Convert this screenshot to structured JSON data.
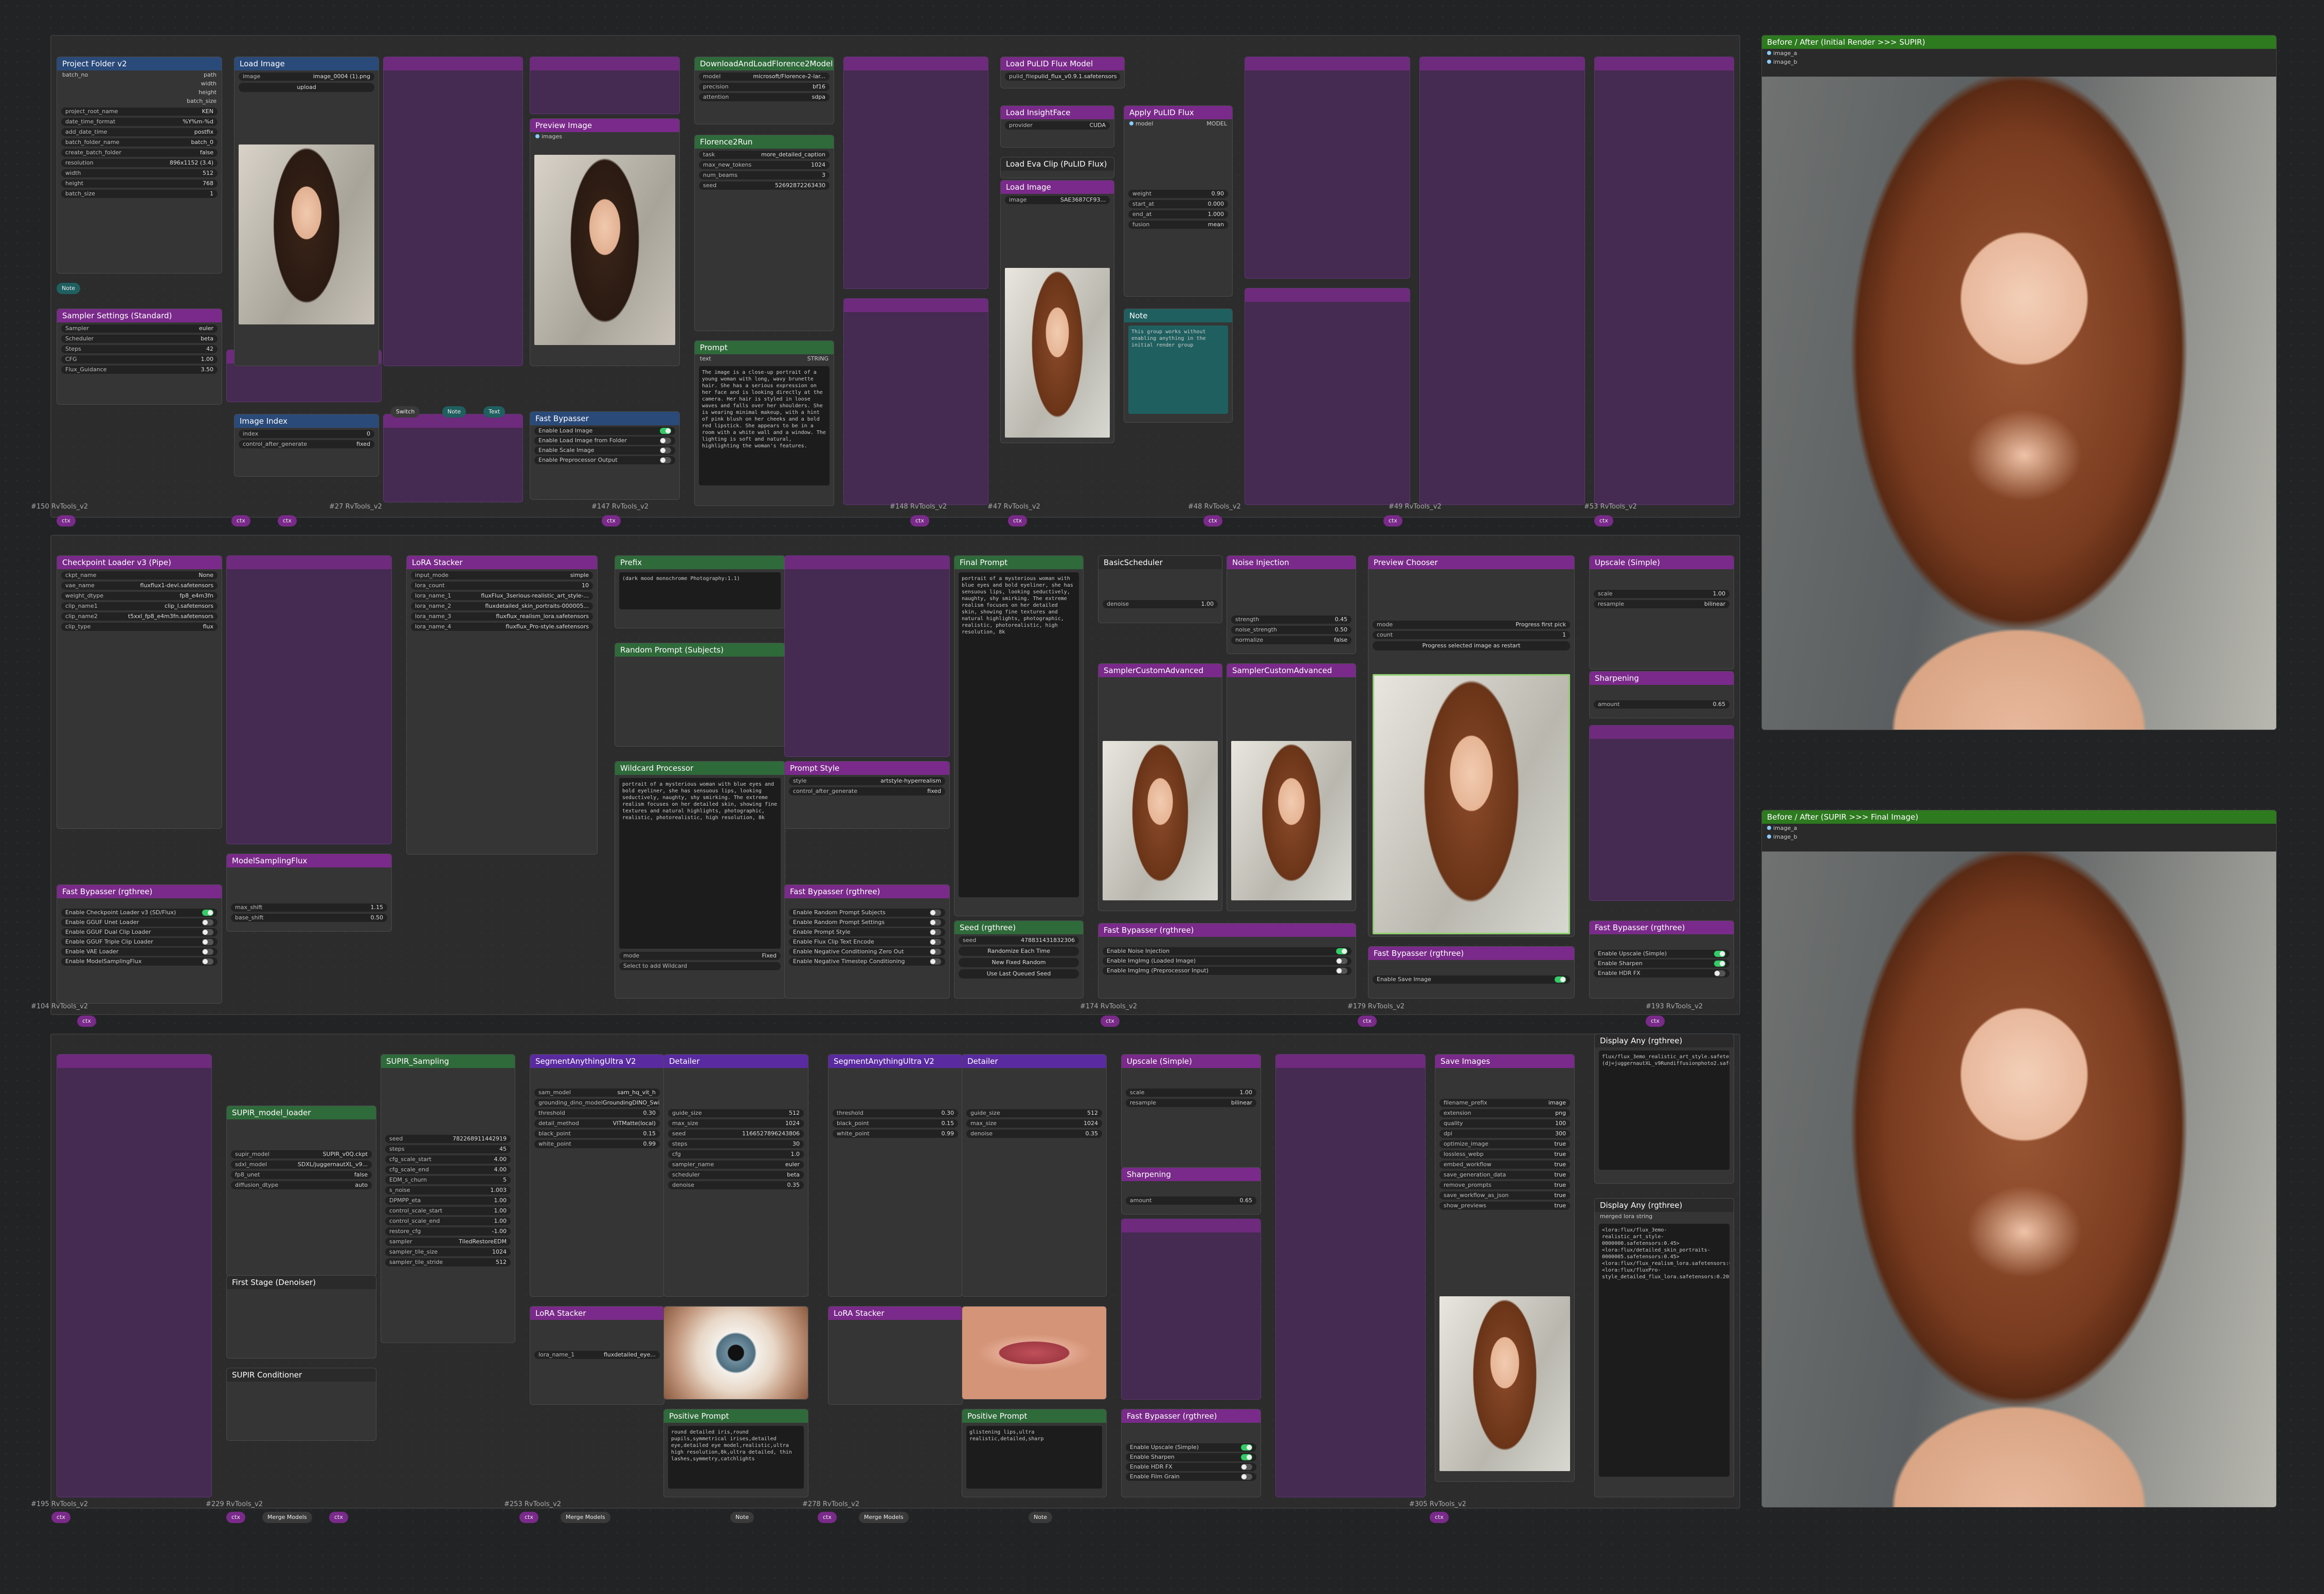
{
  "colors": {
    "canvas": "#222325",
    "node_bg": "#353535",
    "muted": "#4a2a58",
    "title_purple": "#7a2a8a",
    "title_green": "#2f6a3a",
    "title_blue": "#2a4a7a",
    "compare_green": "#2d7a1f",
    "link_blue": "#88ccff"
  },
  "row1": {
    "project": {
      "title": "Project Folder v2",
      "id": "#5 RvTools_v2",
      "project_root_name": "KEN",
      "date_time_format": "%Y%m-%d",
      "add_date_time": "postfix",
      "batch_folder_name": "batch_0",
      "create_batch_folder": "false",
      "relative_path": "",
      "resolution": "896x1152 (3.4)",
      "width": "512",
      "height": "768",
      "batch_size": "1",
      "note": "Note"
    },
    "sampler": {
      "title": "Sampler Settings (Standard)",
      "id": "#4 RvTools_v2",
      "sampler": "euler",
      "scheduler": "beta",
      "steps": "42",
      "cfg": "1.00",
      "flux_guidance": "3.50"
    },
    "load_image": {
      "title": "Load Image",
      "id": "#24",
      "image": "image_0004 (1).png",
      "upload": "upload"
    },
    "image_index": {
      "title": "Image Index",
      "index": "0",
      "control": "fixed"
    },
    "preview": {
      "title": "Preview Image",
      "id": "#20 RvTools_v2",
      "field": "images"
    },
    "fast_bypass": {
      "title": "Fast Bypasser",
      "id": "#25",
      "items": [
        "Enable Load Image",
        "Enable Load Image from Folder",
        "Enable Scale Image",
        "Enable Preprocessor Output"
      ]
    },
    "florence_model": {
      "title": "DownloadAndLoadFlorence2Model",
      "id": "#32 Florence2",
      "model": "microsoft/Florence-2-lar...",
      "precision": "bf16",
      "attention": "sdpa"
    },
    "florence_run": {
      "title": "Florence2Run",
      "id": "#33 Florence2",
      "task": "more_detailed_caption",
      "max_new_tokens": "1024",
      "num_beams": "3",
      "seed": "52692872263430"
    },
    "prompt": {
      "title": "Prompt",
      "field": "text",
      "type": "STRING",
      "text": "The image is a close-up portrait of a young woman with long, wavy brunette hair. She has a serious expression on her face and is looking directly at the camera. Her hair is styled in loose waves and falls over her shoulders. She is wearing minimal makeup, with a hint of pink blush on her cheeks and a bold red lipstick. She appears to be in a room with a white wall and a window. The lighting is soft and natural, highlighting the woman's features."
    },
    "pulid": {
      "title": "Load PuLID Flux Model",
      "id": "#44 PuLID-Flux-Enhanced",
      "file": "pulid_flux_v0.9.1.safetensors",
      "eva": "Load Eva Clip (PuLID Flux)",
      "insight": "Load InsightFace",
      "provider": "CUDA",
      "apply": "Apply PuLID Flux",
      "weight": "0.90",
      "start_at": "0.000",
      "end_at": "1.000",
      "fusion": "mean",
      "image_label": "Load Image",
      "image_file": "SAE3687CF93...",
      "note": "Note",
      "note_text": "This group works without enabling anything in the initial render group"
    }
  },
  "row2": {
    "ckpt": {
      "title": "Checkpoint Loader v3 (Pipe)",
      "id": "#110 RvTools_v2",
      "ckpt_name": "None",
      "vae_name": "fluxflux1-devl.safetensors",
      "weight_dtype": "fp8_e4m3fn",
      "clip_name1": "clip_l.safetensors",
      "clip_name2": "t5xxl_fp8_e4m3fn.safetensors",
      "clip_type": "flux"
    },
    "lora": {
      "title": "LoRA Stacker",
      "id": "#116 efficiency-nodes-comfyui",
      "input_mode": "simple",
      "lora_count": "10",
      "lora_name_1": "fluxFlux_3serious-realistic_art_style-...",
      "lora_name_2": "fluxdetailed_skin_portraits-000005...",
      "lora_name_3": "fluxflux_realism_lora.safetensors",
      "lora_name_4": "fluxflux_Pro-style.safetensors"
    },
    "fast_bypass_rg": {
      "title": "Fast Bypasser (rgthree)",
      "items": [
        "Enable Checkpoint Loader v3 (SD/Flux)",
        "Enable GGUF Unet Loader",
        "Enable GGUF Dual Clip Loader",
        "Enable GGUF Triple Clip Loader",
        "Enable VAE Loader",
        "Enable ModelSamplingFlux"
      ]
    },
    "model_sampling": {
      "title": "ModelSamplingFlux",
      "max_shift": "1.15",
      "base_shift": "0.50"
    },
    "prefix": {
      "title": "Prefix",
      "id": "#143 RvTools_v2",
      "text": "(dark mood monochrome Photography:1.1)"
    },
    "random_subjects": {
      "title": "Random Prompt (Subjects)",
      "id": "#141 Impact-Pack"
    },
    "wildcard": {
      "title": "Wildcard Processor",
      "field": "seed",
      "text": "portrait of a mysterious woman with blue eyes and bold eyeliner, she has sensuous lips, looking seductively, naughty, shy smirking. The extreme realism focuses on her detailed skin, showing fine textures and natural highlights, photographic, realistic, photorealistic, high resolution, 8k",
      "mode": "Fixed",
      "select": "Select to add Wildcard"
    },
    "prompt_style": {
      "title": "Prompt Style",
      "style": "artstyle-hyperrealism",
      "control": "fixed"
    },
    "final_prompt": {
      "title": "Final Prompt",
      "id": "#139 Custom-Scripts"
    },
    "seed": {
      "title": "Seed (rgthree)",
      "id": "#140 rgthree-comfy",
      "seed": "478831431832306",
      "randomize": "Randomize Each Time",
      "new_fixed": "New Fixed Random",
      "last": "Use Last Queued Seed"
    },
    "fast_bypass_seed": {
      "title": "Fast Bypasser (rgthree)",
      "items": [
        "Enable Random Prompt Subjects",
        "Enable Random Prompt Settings",
        "Enable Prompt Style",
        "Enable Flux Clip Text Encode",
        "Enable Negative Conditioning Zero Out",
        "Enable Negative Timestep Conditioning"
      ]
    },
    "basic_scheduler": {
      "title": "BasicScheduler",
      "id": "#172",
      "denoise": "1.00"
    },
    "noise_injection": {
      "title": "Noise Injection",
      "id": "#168 CS_NoiseInjection",
      "strength": "0.45",
      "noise_strength": "0.50",
      "normalize": "false"
    },
    "sampler_adv": {
      "title": "SamplerCustomAdvanced",
      "id": "#179"
    },
    "chooser": {
      "title": "Preview Chooser",
      "id": "#182 cg-image-picker",
      "mode": "Progress first pick",
      "count": "1",
      "status": "Progress selected image as restart"
    },
    "upscale": {
      "title": "Upscale (Simple)",
      "id": "#188 comfy_mtb",
      "scale": "1.00",
      "resample": "bilinear"
    },
    "sharpen": {
      "title": "Sharpening",
      "amount": "0.65"
    },
    "fast_bypass_inj": {
      "title": "Fast Bypasser (rgthree)",
      "items": [
        "Enable Noise Injection",
        "Enable ImgImg (Loaded Image)",
        "Enable ImgImg (Preprocessor Input)"
      ]
    },
    "fast_bypass_save": {
      "title": "Fast Bypasser (rgthree)",
      "items": [
        "Enable Save Image"
      ]
    },
    "fast_bypass_up": {
      "title": "Fast Bypasser (rgthree)",
      "items": [
        "Enable Upscale (Simple)",
        "Enable Sharpen",
        "Enable HDR FX"
      ]
    }
  },
  "row3": {
    "supir": {
      "title": "SUPIR_Sampling",
      "id": "#228 SUPIR_Sampling",
      "seed": "782268911442919",
      "steps": "45",
      "cfg_scale_start": "4.00",
      "cfg_scale_end": "4.00",
      "EDM_s_churn": "5",
      "s_noise": "1.003",
      "DPMPP_eta": "1.00",
      "control_scale_start": "1.00",
      "control_scale_end": "1.00",
      "restore_cfg": "-1.00",
      "sampler": "TiledRestoreEDM",
      "sampler_tile_size": "1024",
      "sampler_tile_stride": "512"
    },
    "supir_model": {
      "title": "SUPIR_model_loader",
      "id": "#221 SUPIR_ModelLoader",
      "supir_model": "SUPIR_v0Q.ckpt",
      "sdxl_model": "SDXL/juggernautXL_v9...",
      "fp8_unet": "false",
      "diffusion_dtype": "auto"
    },
    "supir_conditioner": {
      "title": "SUPIR Conditioner",
      "id": "#225"
    },
    "first_stage": {
      "title": "First Stage (Denoiser)"
    },
    "seg1": {
      "title": "SegmentAnythingUltra V2",
      "id": "#254 LayerStyle_Advance",
      "sam_model": "sam_hq_vit_h",
      "grounding": "GroundingDINO_SwinB (938MB)",
      "threshold": "0.30",
      "detail_method": "VITMatte(local)",
      "black_point": "0.15",
      "white_point": "0.99"
    },
    "detailer1": {
      "title": "Detailer",
      "id": "#245 Detailer",
      "guide_size": "512",
      "max_size": "1024",
      "seed": "1166527896243806",
      "steps": "30",
      "cfg": "1.0",
      "sampler": "euler",
      "scheduler": "beta",
      "denoise": "0.35"
    },
    "eye_lora": {
      "title": "LoRA Stacker",
      "id": "#244 efficiency-nodes-comfyui",
      "lora_name_1": "fluxdetailed_eye..."
    },
    "seg2": {
      "title": "SegmentAnythingUltra V2",
      "id": "#283 LayerStyle_Advance",
      "threshold": "0.30",
      "black_point": "0.15",
      "white_point": "0.99"
    },
    "detailer2": {
      "title": "Detailer",
      "id": "#277 Detailer",
      "guide_size": "512",
      "max_size": "1024",
      "denoise": "0.35"
    },
    "lip_lora": {
      "title": "LoRA Stacker",
      "id": "#275 efficiency-nodes-comfyui"
    },
    "pos_prompt1": {
      "title": "Positive Prompt",
      "text": "round detailed iris,round pupils,symmetrical irises,detailed eye,detailed eye model,realistic,ultra high resolution,8k,ultra detailed, thin lashes,symmetry,catchlights"
    },
    "pos_prompt2": {
      "title": "Positive Prompt",
      "text": "glistening lips,ultra realistic,detailed,sharp"
    },
    "upscale3": {
      "title": "Upscale (Simple)",
      "id": "#295 comfy_mtb",
      "scale": "1.00",
      "resample": "bilinear"
    },
    "sharpen3": {
      "title": "Sharpening",
      "id": "#287 essentials",
      "amount": "0.65"
    },
    "save": {
      "title": "Save Images",
      "id": "#307 RvTools_v2",
      "filename_prefix": "image",
      "format": "png",
      "quality": "100",
      "dpi": "300",
      "optimize_image": "true",
      "lossless_webp": "true",
      "embed_workflow": "true",
      "save_generation_data": "true",
      "remove_prompts": "true",
      "save_workflow_as_json": "true",
      "show_previews": "true"
    },
    "display1": {
      "title": "Display Any (rgthree)",
      "id": "#309 rgthree-comfy",
      "text": "flux/flux_3emo_realistic_art_style.safetensors, (dj=juggernautXL_v9Rundiffusionphoto2.safetensors)"
    },
    "display2": {
      "title": "Display Any (rgthree)",
      "id": "#308 rgthree-comfy",
      "field": "merged lora string",
      "text": "<lora:flux/flux_3emo-realistic_art_style-0000000.safetensors:0.45>\n<lora:flux/detailed_skin_portraits-0000005.safetensors:0.45>\n<lora:flux/flux_realism_lora.safetensors:0.15>\n<lora:flux/fluxPro-style_detailed_flux_lora.safetensors:0.20>"
    },
    "fast_bypass_final": {
      "title": "Fast Bypasser (rgthree)",
      "items": [
        "Enable Upscale (Simple)",
        "Enable Sharpen",
        "Enable HDR FX",
        "Enable Film Grain"
      ]
    }
  },
  "compare": [
    {
      "title": "Before / After (Initial Render >>> SUPIR)",
      "id": "#310 rgthree-comfy",
      "in_a": "image_a",
      "in_b": "image_b"
    },
    {
      "title": "Before / After (SUPIR >>> Final Image)",
      "id": "#311 rgthree-comfy",
      "in_a": "image_a",
      "in_b": "image_b"
    }
  ],
  "chips": {
    "bc": "ctx",
    "merge": "Merge Models",
    "note": "Note",
    "switch": "Switch",
    "text": "Text"
  },
  "labels": {
    "l1": "#150 RvTools_v2",
    "l2": "#27 RvTools_v2",
    "l3": "#147 RvTools_v2",
    "l4": "#148 RvTools_v2",
    "l5": "#47 RvTools_v2",
    "l6": "#48 RvTools_v2",
    "l7": "#49 RvTools_v2",
    "l8": "#53 RvTools_v2",
    "l9": "#104 RvTools_v2",
    "l10": "#174 RvTools_v2",
    "l11": "#179 RvTools_v2",
    "l12": "#193 RvTools_v2",
    "l13": "#195 RvTools_v2",
    "l14": "#229 RvTools_v2",
    "l15": "#253 RvTools_v2",
    "l16": "#278 RvTools_v2",
    "l17": "#305 RvTools_v2"
  }
}
